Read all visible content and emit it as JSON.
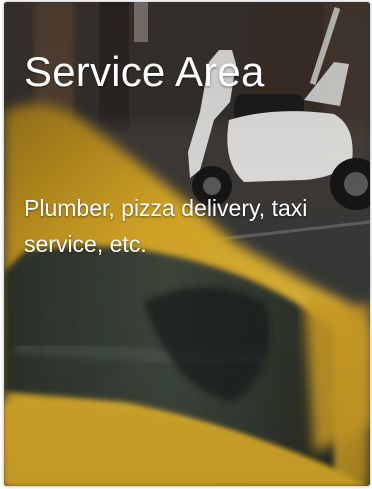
{
  "card": {
    "title": "Service Area",
    "description": "Plumber, pizza delivery, taxi service, etc."
  },
  "colors": {
    "text": "#ffffff",
    "taxi_yellow": "#e0b21e",
    "scooter_white": "#eeeeee",
    "street": "#3c3c3a"
  }
}
